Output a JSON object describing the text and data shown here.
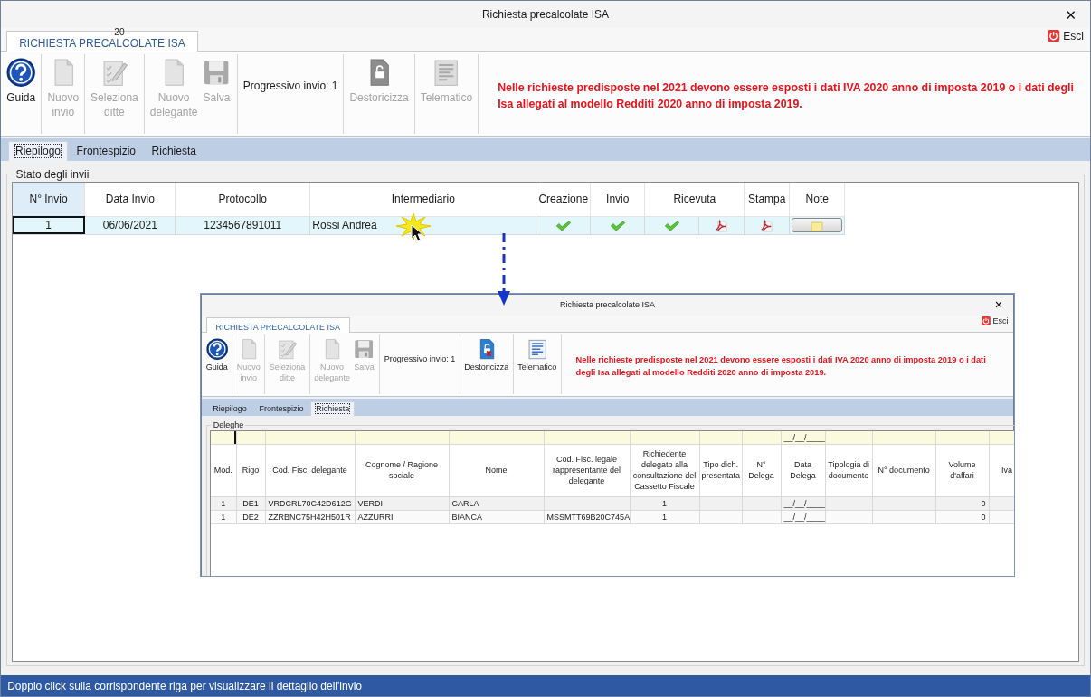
{
  "window": {
    "title": "Richiesta precalcolate ISA",
    "close": "✕"
  },
  "ribbon": {
    "tab": {
      "label": "RICHIESTA PRECALCOLATE ISA",
      "selected": true
    },
    "tab_overlay": "20",
    "exit": "Esci"
  },
  "toolbar": {
    "groups": [
      [
        {
          "kind": "help",
          "label": "Guida",
          "disabled": false
        }
      ],
      [
        {
          "kind": "new",
          "label": "Nuovo invio",
          "disabled": true
        }
      ],
      [
        {
          "kind": "select",
          "label": "Seleziona ditte",
          "disabled": true
        }
      ],
      [
        {
          "kind": "new",
          "label": "Nuovo delegante",
          "disabled": true
        },
        {
          "kind": "save",
          "label": "Salva",
          "disabled": true
        }
      ],
      [
        {
          "kind": "info",
          "label": "Progressivo invio: 1"
        }
      ],
      [
        {
          "kind": "unlock",
          "label": "Destoricizza",
          "disabled": true
        }
      ],
      [
        {
          "kind": "telematic",
          "label": "Telematico",
          "disabled": true
        }
      ]
    ],
    "notice": "Nelle richieste predisposte nel 2021 devono essere esposti i dati IVA 2020 anno di imposta 2019 o i dati degli Isa allegati al modello Redditi 2020 anno di imposta 2019."
  },
  "tabs": [
    {
      "label": "Riepilogo",
      "selected": true
    },
    {
      "label": "Frontespizio",
      "selected": false
    },
    {
      "label": "Richiesta",
      "selected": false
    }
  ],
  "group": {
    "title": "Stato degli invii",
    "table": {
      "columns": [
        {
          "label": "N° Invio",
          "selected": true
        },
        {
          "label": "Data Invio",
          "selected": false
        },
        {
          "label": "Protocollo",
          "selected": false
        },
        {
          "label": "Intermediario",
          "selected": false
        },
        {
          "label": "Creazione",
          "selected": false
        },
        {
          "label": "Invio",
          "selected": false
        },
        {
          "label": "Ricevuta",
          "selected": false
        },
        {
          "label": "Stampa",
          "selected": false
        },
        {
          "label": "Note",
          "selected": false
        }
      ],
      "rows": [
        {
          "selected": true,
          "cells": [
            {
              "kind": "text",
              "text": "1"
            },
            {
              "kind": "text",
              "text": "06/06/2021"
            },
            {
              "kind": "text",
              "text": "1234567891011"
            },
            {
              "kind": "text",
              "text": "Rossi Andrea"
            },
            {
              "kind": "status",
              "done": true
            },
            {
              "kind": "status",
              "done": true
            },
            {
              "kind": "receipt",
              "done": true
            },
            {
              "kind": "print"
            },
            {
              "kind": "note"
            }
          ]
        }
      ]
    }
  },
  "inset": {
    "window": {
      "title": "Richiesta precalcolate ISA",
      "close": "✕"
    },
    "ribbon": {
      "tab": {
        "label": "RICHIESTA PRECALCOLATE ISA",
        "selected": true
      },
      "exit": "Esci"
    },
    "toolbar": {
      "groups": [
        [
          {
            "kind": "help",
            "label": "Guida",
            "disabled": false
          }
        ],
        [
          {
            "kind": "new",
            "label": "Nuovo invio",
            "disabled": true
          }
        ],
        [
          {
            "kind": "select",
            "label": "Seleziona ditte",
            "disabled": true
          }
        ],
        [
          {
            "kind": "new",
            "label": "Nuovo delegante",
            "disabled": true
          },
          {
            "kind": "save",
            "label": "Salva",
            "disabled": true
          }
        ],
        [
          {
            "kind": "info",
            "label": "Progressivo invio: 1"
          }
        ],
        [
          {
            "kind": "unlock",
            "label": "Destoricizza",
            "disabled": false
          }
        ],
        [
          {
            "kind": "telematic",
            "label": "Telematico",
            "disabled": false
          }
        ]
      ],
      "notice": "Nelle richieste predisposte nel 2021 devono essere esposti i dati IVA 2020 anno di imposta 2019 o i dati degli Isa allegati al modello Redditi 2020 anno di imposta 2019."
    },
    "tabs": [
      {
        "label": "Riepilogo",
        "selected": false
      },
      {
        "label": "Frontespizio",
        "selected": false
      },
      {
        "label": "Richiesta",
        "selected": true
      }
    ],
    "group": {
      "title": "Deleghe",
      "table": {
        "columns": [
          {
            "label": "Mod."
          },
          {
            "label": "Rigo"
          },
          {
            "label": "Cod. Fisc. delegante"
          },
          {
            "label": "Cognome / Ragione sociale"
          },
          {
            "label": "Nome"
          },
          {
            "label": "Cod. Fisc. legale rappresentante del delegante"
          },
          {
            "label": "Richiedente delegato alla consultazione del Cassetto Fiscale"
          },
          {
            "label": "Tipo dich. presentata"
          },
          {
            "label": "N° Delega"
          },
          {
            "label": "Data Delega",
            "filter": "__/__/____"
          },
          {
            "label": "Tipologia di documento"
          },
          {
            "label": "N° documento"
          },
          {
            "label": "Volume d'affari"
          },
          {
            "label": "Iva"
          }
        ],
        "rows": [
          [
            "1",
            "DE1",
            "VRDCRL70C42D612G",
            "VERDI",
            "CARLA",
            null,
            "1",
            null,
            null,
            "__/__/____",
            null,
            null,
            "0",
            null
          ],
          [
            "1",
            "DE2",
            "ZZRBNC75H42H501R",
            "AZZURRI",
            "BIANCA",
            "MSSMTT69B20C745A",
            "1",
            null,
            null,
            "__/__/____",
            null,
            null,
            "0",
            null
          ]
        ]
      }
    }
  },
  "status_bar": "Doppio click sulla corrispondente riga per visualizzare il dettaglio dell'invio"
}
